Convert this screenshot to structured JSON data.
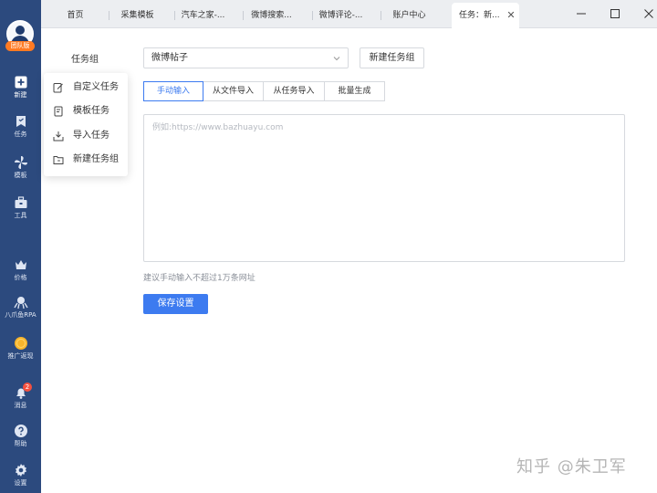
{
  "sidebar": {
    "team_badge": "团队版",
    "items": [
      {
        "label": "新建",
        "icon": "plus-square-icon"
      },
      {
        "label": "任务",
        "icon": "bookmark-icon"
      },
      {
        "label": "模板",
        "icon": "pinwheel-icon"
      },
      {
        "label": "工具",
        "icon": "toolbox-icon"
      },
      {
        "label": "价格",
        "icon": "crown-icon"
      },
      {
        "label": "八爪鱼RPA",
        "icon": "octopus-icon"
      },
      {
        "label": "推广返现",
        "icon": "coin-icon"
      },
      {
        "label": "消息",
        "icon": "bell-icon",
        "badge": "2"
      },
      {
        "label": "帮助",
        "icon": "help-icon"
      },
      {
        "label": "设置",
        "icon": "gear-icon"
      }
    ]
  },
  "tabs": [
    {
      "label": "首页"
    },
    {
      "label": "采集模板"
    },
    {
      "label": "汽车之家-..."
    },
    {
      "label": "微博搜索..."
    },
    {
      "label": "微博评论-..."
    },
    {
      "label": "账户中心"
    },
    {
      "label": "任务：新..."
    }
  ],
  "form": {
    "group_label": "任务组",
    "group_value": "微博帖子",
    "new_group_button": "新建任务组",
    "modes": [
      "手动输入",
      "从文件导入",
      "从任务导入",
      "批量生成"
    ],
    "active_mode": "手动输入",
    "url_placeholder": "例如:https://www.bazhuayu.com",
    "hint": "建议手动输入不超过1万条网址",
    "save_button": "保存设置"
  },
  "menu": {
    "items": [
      {
        "label": "自定义任务",
        "icon": "edit-icon"
      },
      {
        "label": "模板任务",
        "icon": "template-icon"
      },
      {
        "label": "导入任务",
        "icon": "import-icon"
      },
      {
        "label": "新建任务组",
        "icon": "folder-icon"
      }
    ]
  },
  "watermark": "知乎 @朱卫军",
  "colors": {
    "sidebar": "#2c4a7e",
    "accent": "#3d7bf0",
    "badge": "#ff7a22"
  }
}
